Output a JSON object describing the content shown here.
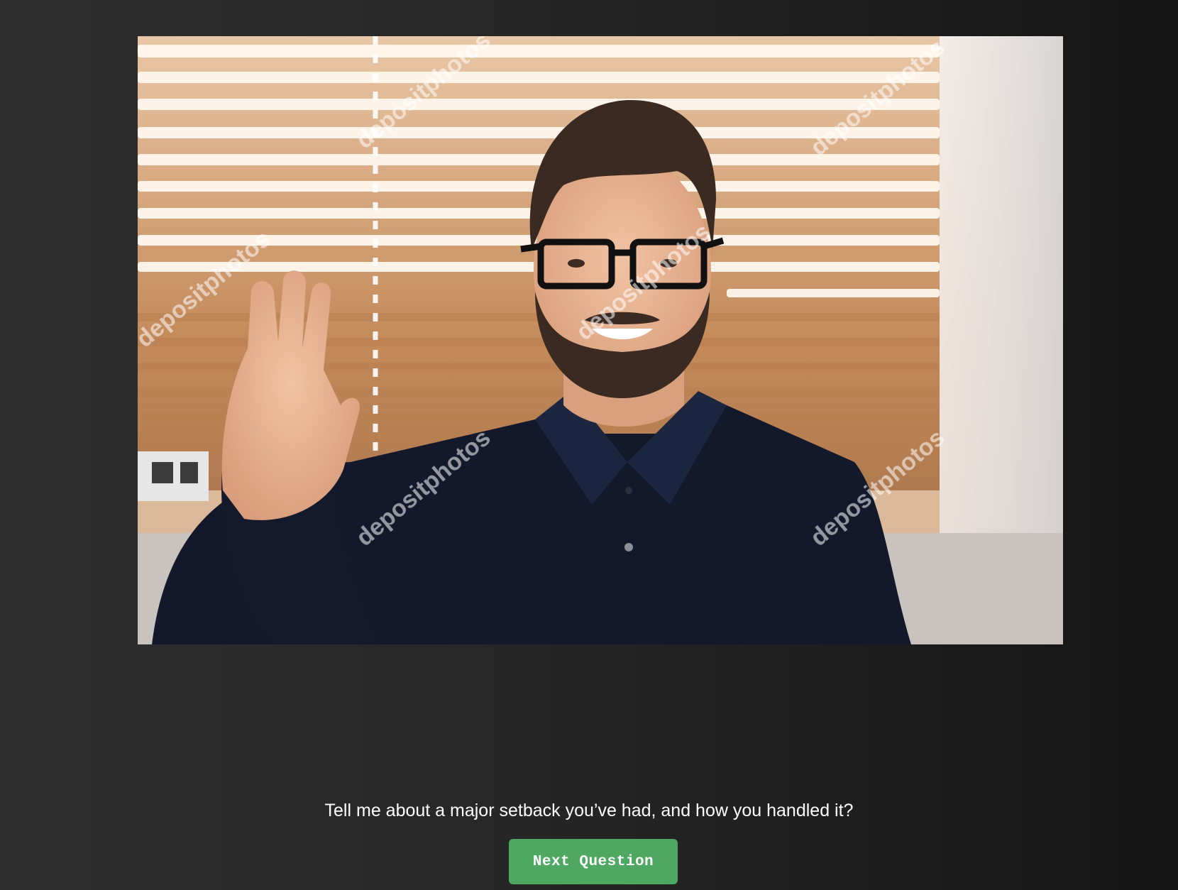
{
  "video": {
    "watermark_text": "depositphotos"
  },
  "question": {
    "text": "Tell me about a major setback you’ve had, and how you handled it?"
  },
  "controls": {
    "next_label": "Next Question"
  },
  "colors": {
    "background": "#222222",
    "button": "#4fa862",
    "text": "#ffffff"
  }
}
